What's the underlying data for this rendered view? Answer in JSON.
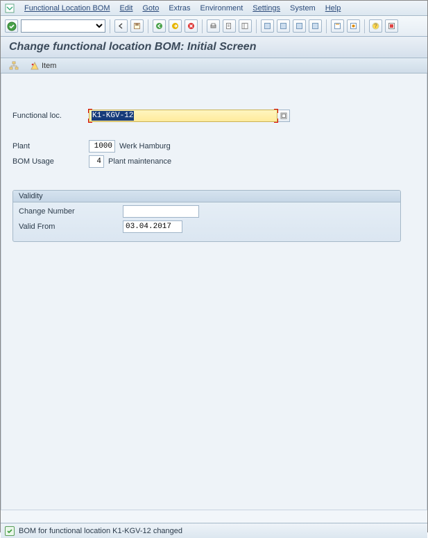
{
  "menu": {
    "items": [
      "Functional Location BOM",
      "Edit",
      "Goto",
      "Extras",
      "Environment",
      "Settings",
      "System",
      "Help"
    ],
    "underline_idx": [
      0,
      0,
      0,
      1,
      2,
      0,
      1,
      0
    ]
  },
  "toolbar": {
    "checkmark": "enter-icon",
    "combo_value": "",
    "icons": [
      "back-icon",
      "save-icon",
      "prev-icon",
      "next-icon",
      "cancel-icon",
      "print-icon",
      "find-icon",
      "find-next-icon",
      "first-icon",
      "prev-page-icon",
      "next-page-icon",
      "last-icon",
      "new-session-icon",
      "shortcut-icon",
      "help-icon",
      "customize-icon"
    ]
  },
  "title": "Change functional location BOM: Initial Screen",
  "app_toolbar": {
    "header_btn": "header-icon",
    "item_btn_icon": "item-icon",
    "item_label": "Item"
  },
  "form": {
    "funcloc_label": "Functional loc.",
    "funcloc_value": "K1-KGV-12",
    "plant_label": "Plant",
    "plant_value": "1000",
    "plant_desc": "Werk Hamburg",
    "usage_label": "BOM Usage",
    "usage_value": "4",
    "usage_desc": "Plant maintenance"
  },
  "validity": {
    "title": "Validity",
    "change_label": "Change Number",
    "change_value": "",
    "valid_from_label": "Valid From",
    "valid_from_value": "03.04.2017"
  },
  "status": {
    "message": "BOM for functional location K1-KGV-12 changed"
  }
}
